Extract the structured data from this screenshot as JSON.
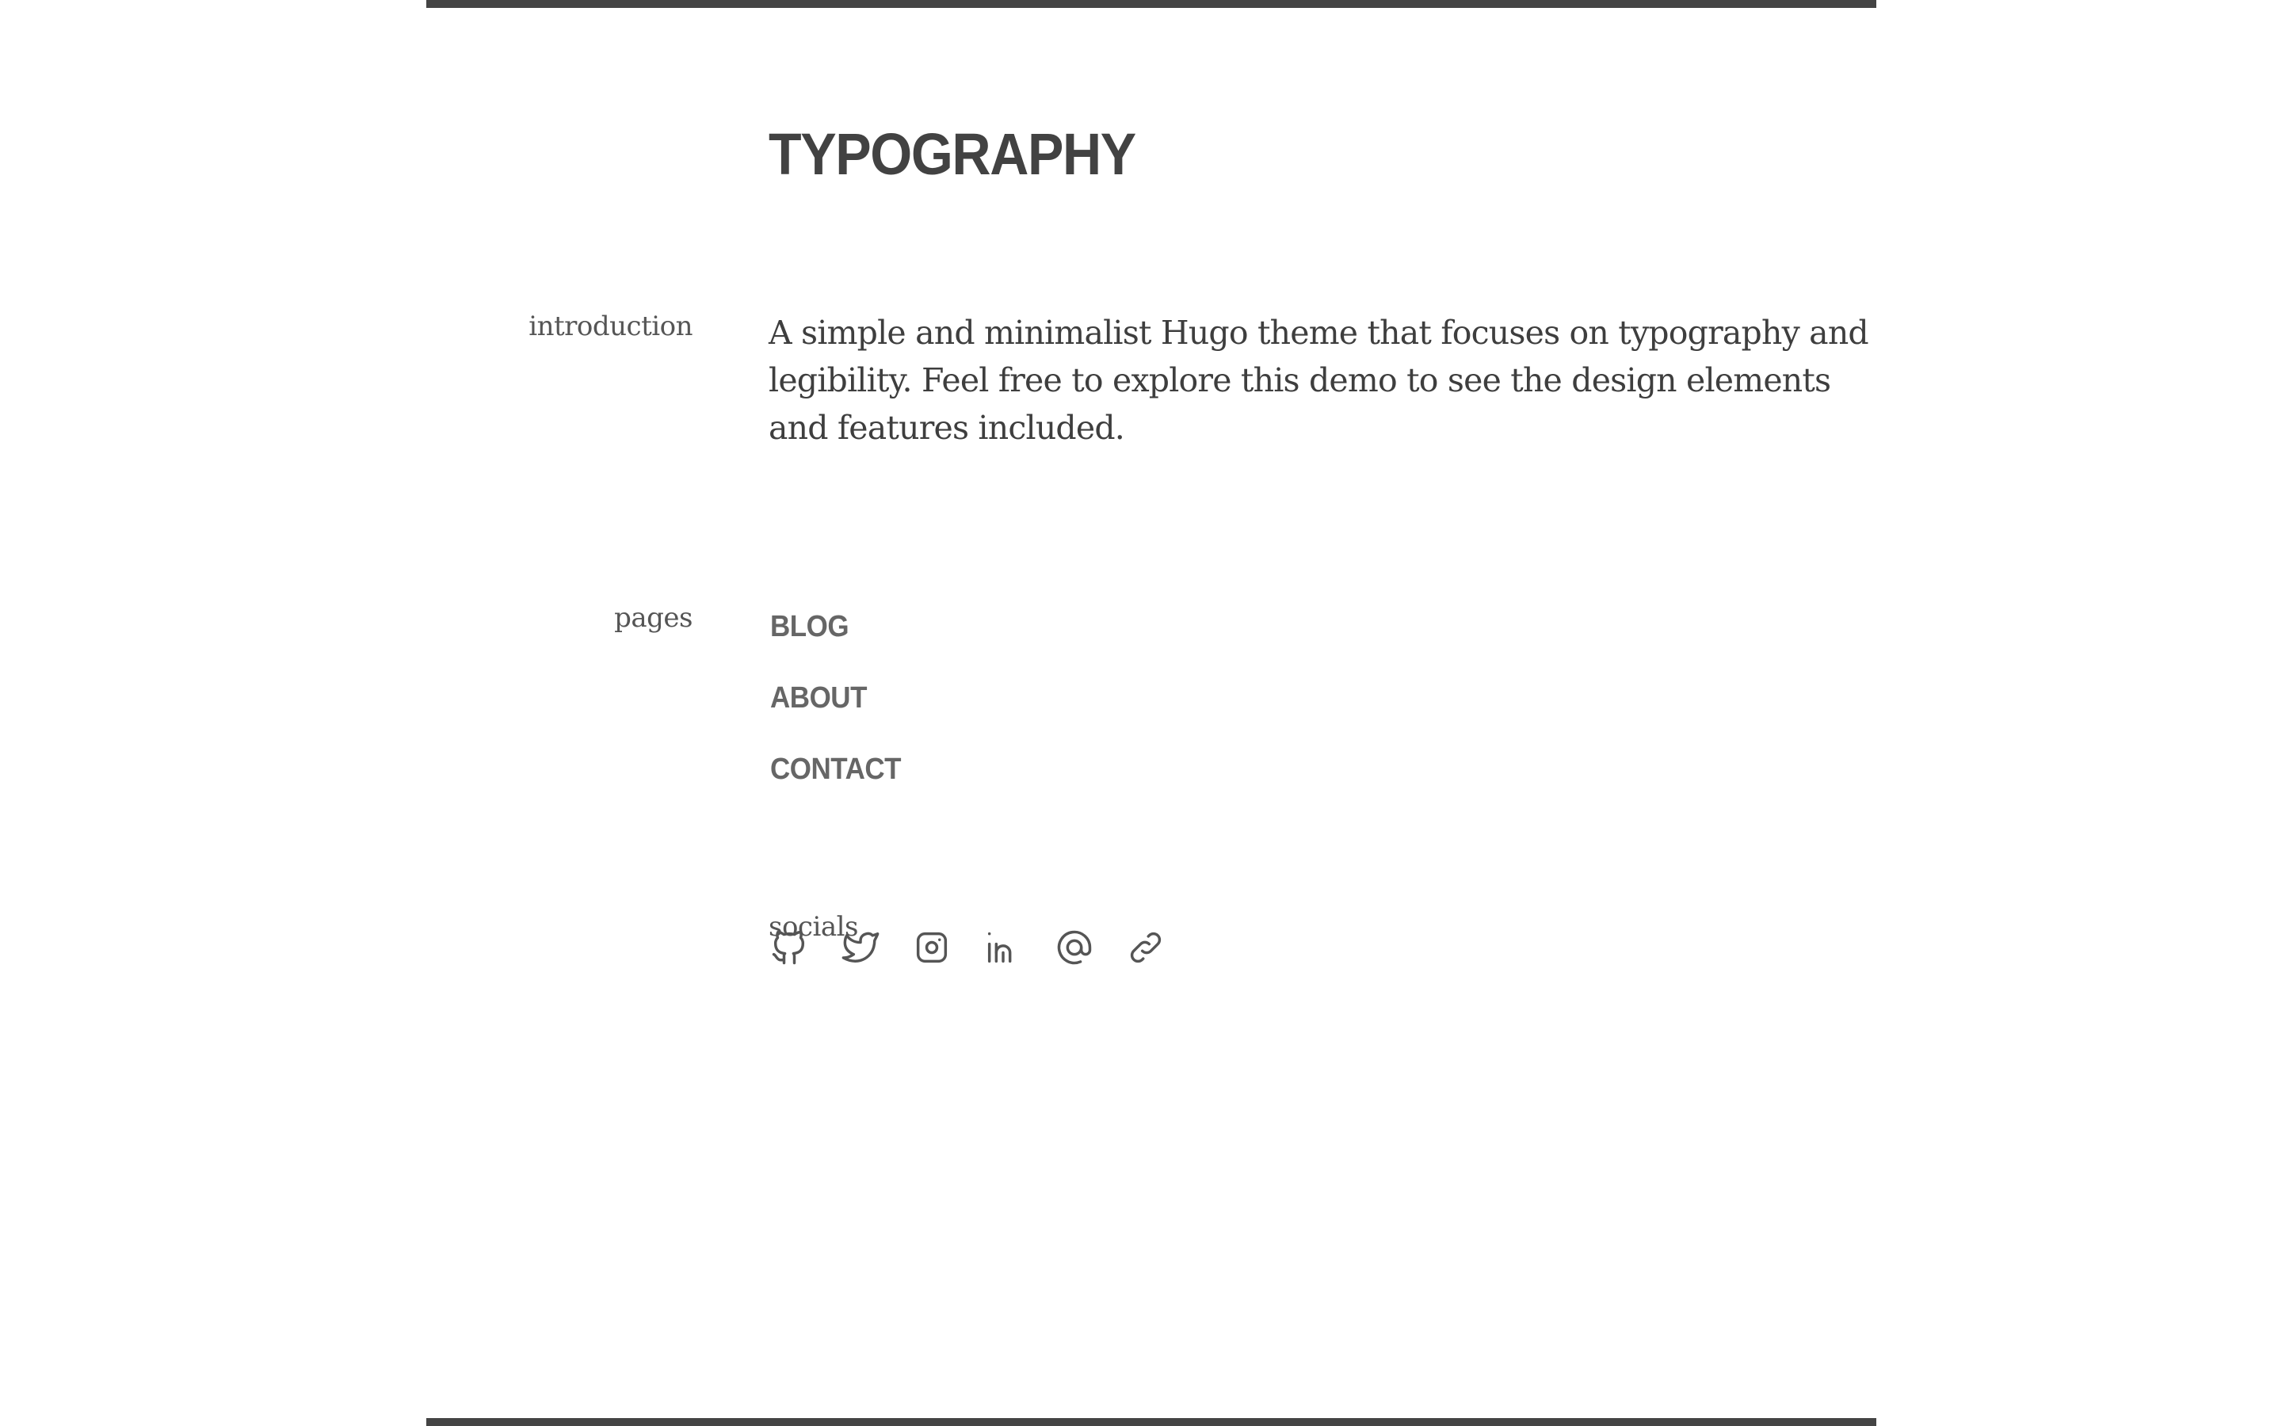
{
  "site": {
    "title": "TYPOGRAPHY"
  },
  "sections": {
    "introduction_label": "introduction",
    "pages_label": "pages",
    "socials_label": "socials"
  },
  "introduction": {
    "text": "A simple and minimalist Hugo theme that focuses on typography and legibility. Feel free to explore this demo to see the design elements and features included."
  },
  "pages": [
    {
      "label": "BLOG"
    },
    {
      "label": "ABOUT"
    },
    {
      "label": "CONTACT"
    }
  ],
  "socials": [
    {
      "icon": "github-icon"
    },
    {
      "icon": "twitter-icon"
    },
    {
      "icon": "instagram-icon"
    },
    {
      "icon": "linkedin-icon"
    },
    {
      "icon": "email-icon"
    },
    {
      "icon": "link-icon"
    }
  ],
  "colors": {
    "rule": "#444444",
    "title": "#424242",
    "text": "#3e3e3e",
    "nav": "#666666",
    "label": "#555555"
  }
}
